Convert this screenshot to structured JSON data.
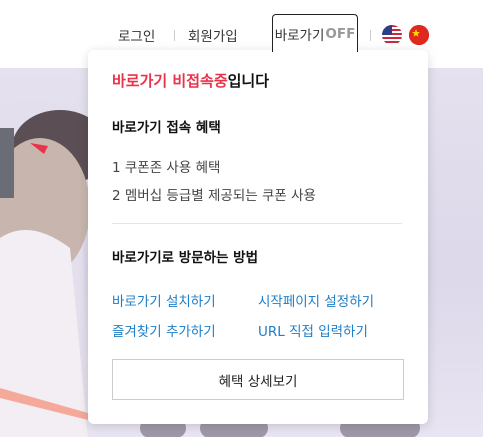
{
  "header": {
    "login_label": "로그인",
    "join_label": "회원가입",
    "shortcut_label": "바로가기",
    "shortcut_state": "OFF",
    "lang_us_icon": "us-flag-icon",
    "lang_cn_icon": "china-flag-icon"
  },
  "popup": {
    "title_highlight": "바로가기 비접속중",
    "title_suffix": "입니다",
    "benefits_title": "바로가기 접속 혜택",
    "benefits": [
      "1 쿠폰존 사용 혜택",
      "2 멤버십 등급별 제공되는 쿠폰 사용"
    ],
    "methods_title": "바로가기로 방문하는 방법",
    "links": {
      "install": "바로가기 설치하기",
      "startpage": "시작페이지 설정하기",
      "bookmark": "즐겨찾기 추가하기",
      "url": "URL 직접 입력하기"
    },
    "detail_button": "혜택 상세보기"
  },
  "colors": {
    "highlight": "#e8334a",
    "link": "#1e7fc8"
  }
}
